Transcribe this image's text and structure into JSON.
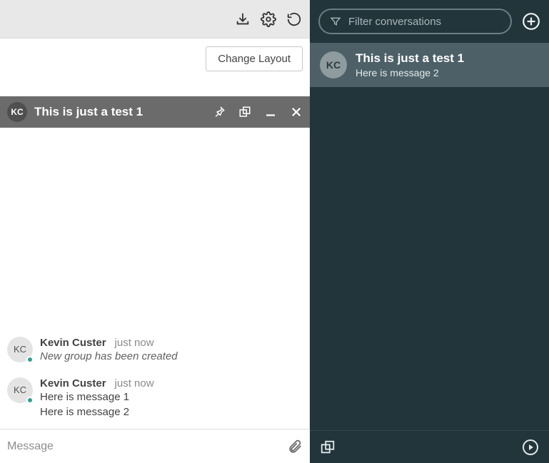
{
  "toolbar": {
    "change_layout_label": "Change Layout"
  },
  "chat_window": {
    "avatar_initials": "KC",
    "title": "This is just a test 1",
    "messages": [
      {
        "avatar": "KC",
        "name": "Kevin Custer",
        "time": "just now",
        "system": true,
        "lines": [
          "New group has been created"
        ]
      },
      {
        "avatar": "KC",
        "name": "Kevin Custer",
        "time": "just now",
        "system": false,
        "lines": [
          "Here is message 1",
          "Here is message 2"
        ]
      }
    ]
  },
  "composer": {
    "placeholder": "Message"
  },
  "sidebar": {
    "filter_placeholder": "Filter conversations",
    "conversations": [
      {
        "avatar": "KC",
        "title": "This is just a test 1",
        "preview": "Here is message 2"
      }
    ]
  }
}
